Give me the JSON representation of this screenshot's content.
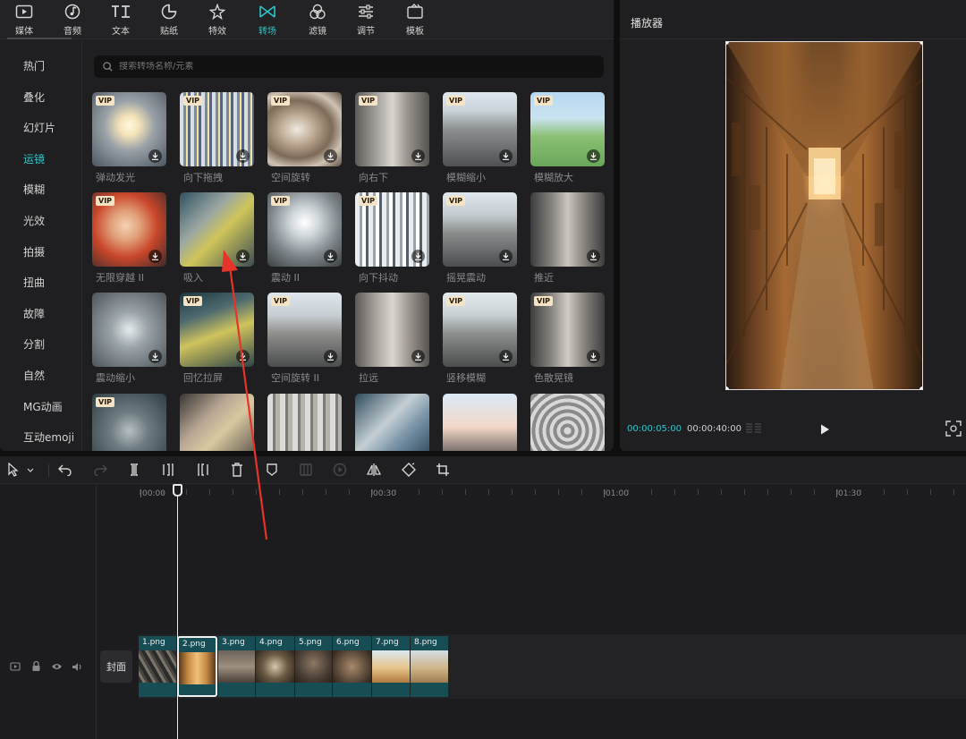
{
  "top_tabs": [
    {
      "label": "媒体",
      "icon": "media-icon"
    },
    {
      "label": "音频",
      "icon": "audio-icon"
    },
    {
      "label": "文本",
      "icon": "text-icon"
    },
    {
      "label": "贴纸",
      "icon": "sticker-icon"
    },
    {
      "label": "特效",
      "icon": "effects-icon"
    },
    {
      "label": "转场",
      "icon": "transition-icon",
      "active": true
    },
    {
      "label": "滤镜",
      "icon": "filter-icon"
    },
    {
      "label": "调节",
      "icon": "adjust-icon"
    },
    {
      "label": "模板",
      "icon": "template-icon"
    }
  ],
  "categories": [
    "热门",
    "叠化",
    "幻灯片",
    "运镜",
    "模糊",
    "光效",
    "拍摄",
    "扭曲",
    "故障",
    "分割",
    "自然",
    "MG动画",
    "互动emoji"
  ],
  "active_category": "运镜",
  "search": {
    "placeholder": "搜索转场名称/元素"
  },
  "vip_badge": "VIP",
  "transitions": [
    {
      "label": "弹动发光",
      "vip": true
    },
    {
      "label": "向下拖拽",
      "vip": true
    },
    {
      "label": "空间旋转",
      "vip": true
    },
    {
      "label": "向右下",
      "vip": true
    },
    {
      "label": "模糊缩小",
      "vip": true
    },
    {
      "label": "模糊放大",
      "vip": true
    },
    {
      "label": "无限穿越 II",
      "vip": true
    },
    {
      "label": "吸入",
      "vip": false
    },
    {
      "label": "震动 II",
      "vip": true
    },
    {
      "label": "向下抖动",
      "vip": true
    },
    {
      "label": "摇晃震动",
      "vip": true
    },
    {
      "label": "推近",
      "vip": false
    },
    {
      "label": "震动缩小",
      "vip": false
    },
    {
      "label": "回忆拉屏",
      "vip": true
    },
    {
      "label": "空间旋转 II",
      "vip": true
    },
    {
      "label": "拉远",
      "vip": false
    },
    {
      "label": "竖移模糊",
      "vip": true
    },
    {
      "label": "色散晃镜",
      "vip": true
    },
    {
      "label": "",
      "vip": true
    },
    {
      "label": "",
      "vip": false
    },
    {
      "label": "",
      "vip": false
    },
    {
      "label": "",
      "vip": false
    },
    {
      "label": "",
      "vip": false
    },
    {
      "label": "",
      "vip": false
    }
  ],
  "player": {
    "title": "播放器",
    "current_time": "00:00:05:00",
    "duration": "00:00:40:00"
  },
  "timeline": {
    "ticks": [
      "|00:00",
      "|00:30",
      "|01:00",
      "|01:30"
    ],
    "cover_label": "封面",
    "clips": [
      "1.png",
      "2.png",
      "3.png",
      "4.png",
      "5.png",
      "6.png",
      "7.png",
      "8.png"
    ],
    "selected_clip": "2.png"
  },
  "colors": {
    "accent": "#2ec5c9",
    "clip": "#174e56",
    "panel": "#1f1f21",
    "annotation": "#e8332a"
  }
}
